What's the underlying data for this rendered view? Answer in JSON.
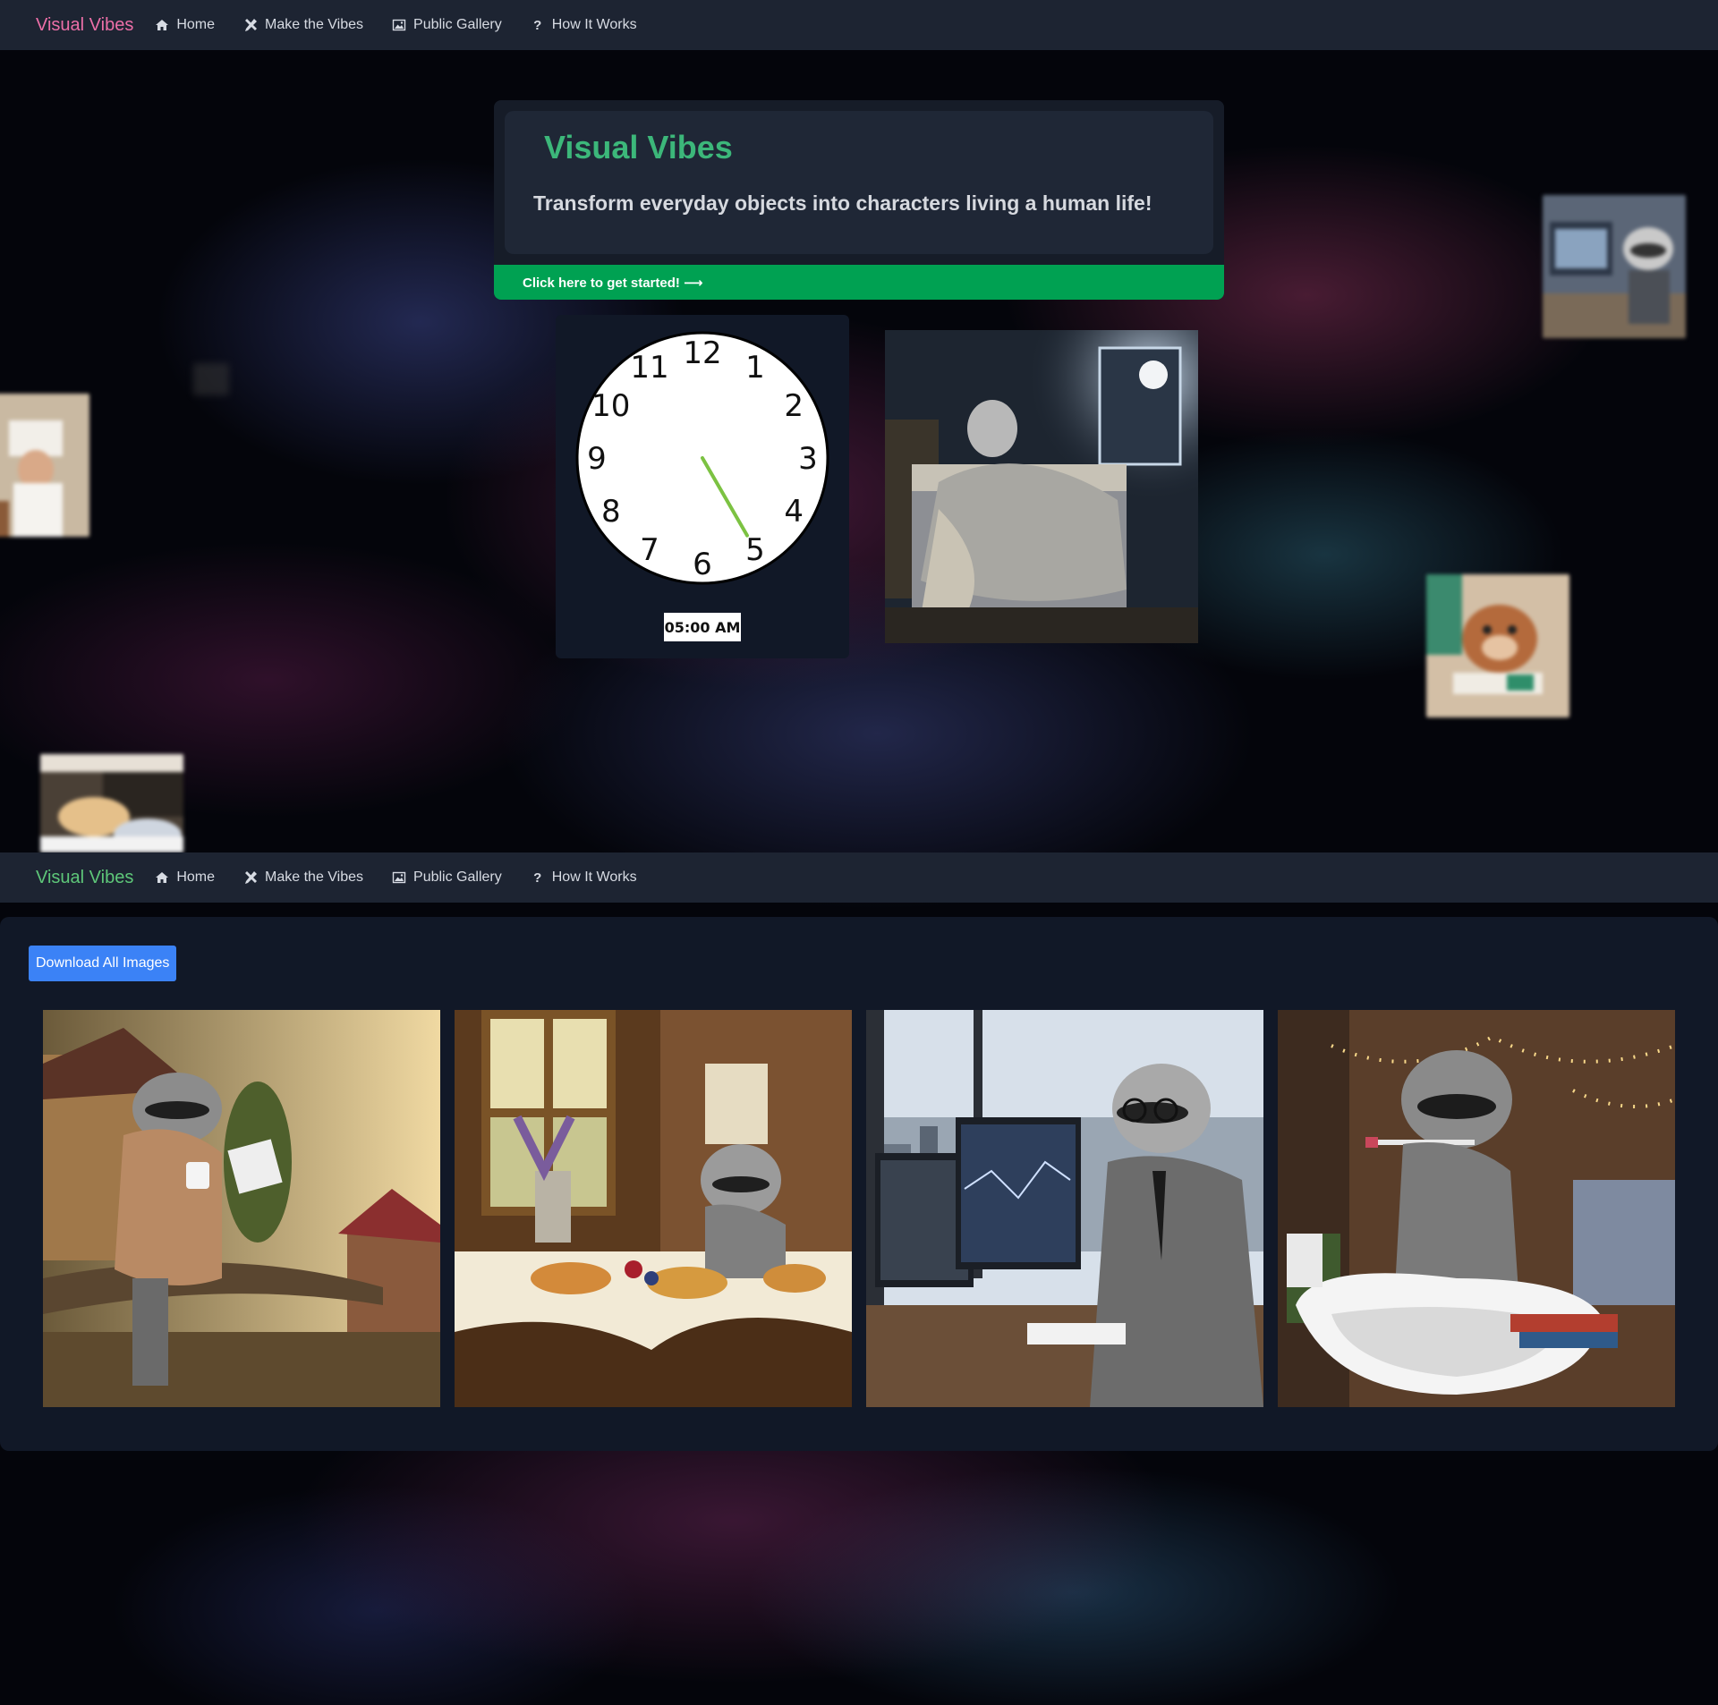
{
  "nav": {
    "brand": "Visual Vibes",
    "items": [
      {
        "label": "Home",
        "icon": "home-icon"
      },
      {
        "label": "Make the Vibes",
        "icon": "tools-icon"
      },
      {
        "label": "Public Gallery",
        "icon": "image-icon"
      },
      {
        "label": "How It Works",
        "icon": "question-icon"
      }
    ]
  },
  "hero": {
    "title": "Visual Vibes",
    "subtitle": "Transform everyday objects into characters living a human life!",
    "cta": "Click here to get started! ⟶"
  },
  "clock": {
    "numbers": [
      "12",
      "1",
      "2",
      "3",
      "4",
      "5",
      "6",
      "7",
      "8",
      "9",
      "10",
      "11"
    ],
    "time_text": "05:00 AM",
    "hand_color": "#7cc242"
  },
  "gallery": {
    "download_label": "Download All Images"
  },
  "colors": {
    "brand_pink": "#ec6fa8",
    "brand_green": "#5ec779",
    "hero_title": "#3cb77a",
    "cta_green": "#00a152",
    "download_blue": "#3b82f6",
    "navbar_bg": "#1d2432",
    "panel_bg": "#111827"
  }
}
